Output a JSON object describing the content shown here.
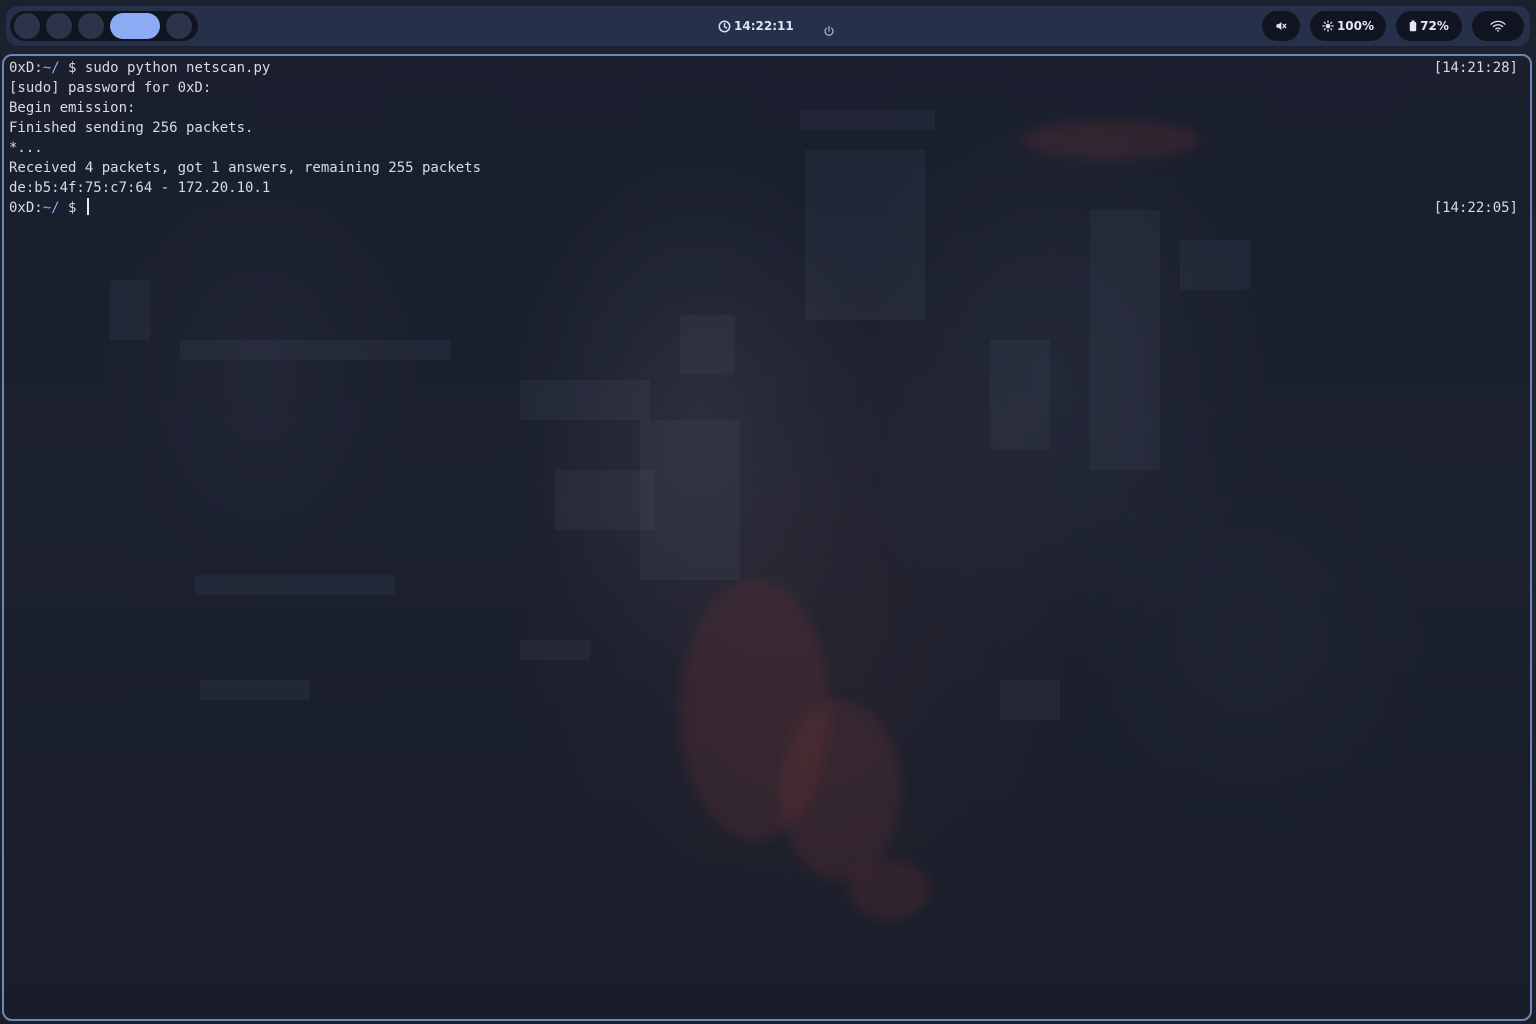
{
  "topbar": {
    "workspaces": [
      {
        "name": "workspace-1",
        "active": false
      },
      {
        "name": "workspace-2",
        "active": false
      },
      {
        "name": "workspace-3",
        "active": false
      },
      {
        "name": "workspace-4",
        "active": true
      },
      {
        "name": "workspace-5",
        "active": false
      }
    ],
    "clock": {
      "icon": "clock-icon",
      "time": "14:22:11"
    },
    "power_icon": "power-icon",
    "volume": {
      "icon": "speaker-muted-icon"
    },
    "brightness": {
      "icon": "brightness-icon",
      "value": "100%"
    },
    "battery": {
      "icon": "battery-icon",
      "value": "72%"
    },
    "network": {
      "icon": "wifi-icon"
    }
  },
  "terminal": {
    "prompt_host": "0xD:",
    "prompt_path": "~/",
    "prompt_symbol": "$",
    "lines": [
      {
        "kind": "command",
        "command": "sudo python netscan.py",
        "timestamp": "[14:21:28]"
      },
      {
        "kind": "output",
        "text": "[sudo] password for 0xD:"
      },
      {
        "kind": "output",
        "text": "Begin emission:"
      },
      {
        "kind": "output",
        "text": "Finished sending 256 packets."
      },
      {
        "kind": "output",
        "text": "*..."
      },
      {
        "kind": "output",
        "text": "Received 4 packets, got 1 answers, remaining 255 packets"
      },
      {
        "kind": "output",
        "text": "de:b5:4f:75:c7:64 - 172.20.10.1"
      },
      {
        "kind": "command",
        "command": "",
        "timestamp": "[14:22:05]"
      }
    ]
  },
  "colors": {
    "accent": "#8cabf5",
    "terminal_border": "#6f86b8",
    "bar_background": "#27304a",
    "pill_background": "#111522",
    "text": "#d6dbe6"
  }
}
